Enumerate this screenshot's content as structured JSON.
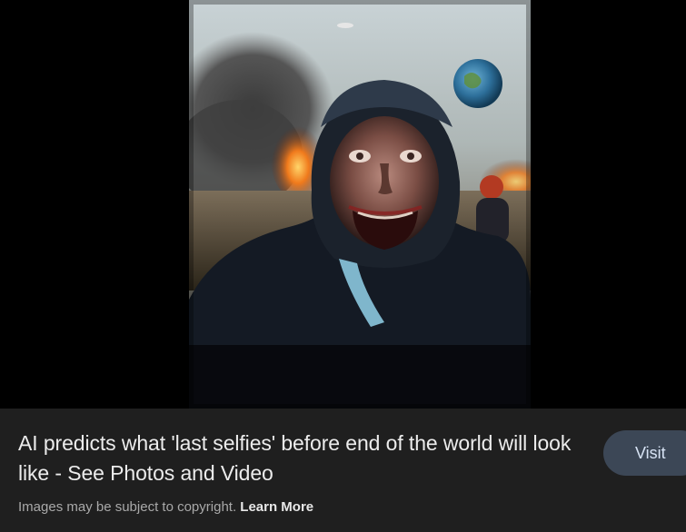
{
  "image": {
    "subject": "ai-generated-apocalypse-selfie"
  },
  "result": {
    "title": "AI predicts what 'last selfies' before end of the world will look like - See Photos and Video",
    "visit_label": "Visit"
  },
  "footer": {
    "copyright_text": "Images may be subject to copyright.",
    "learn_more_label": "Learn More"
  },
  "colors": {
    "panel_background": "#1f1f1f",
    "button_background": "#3c4756",
    "title_text": "#ececec",
    "muted_text": "#a9a9a9"
  }
}
